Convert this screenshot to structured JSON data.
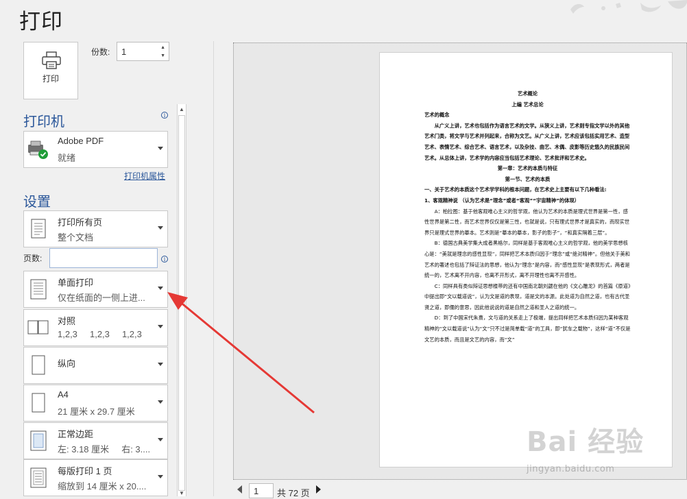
{
  "title": "打印",
  "print_button": {
    "label": "打印",
    "icon": "printer-icon"
  },
  "copies": {
    "label": "份数:",
    "value": "1"
  },
  "printer": {
    "section_title": "打印机",
    "name": "Adobe PDF",
    "status": "就绪",
    "properties_link": "打印机属性"
  },
  "settings": {
    "section_title": "设置",
    "print_range": {
      "line1": "打印所有页",
      "line2": "整个文档"
    },
    "pages_label": "页数:",
    "pages_value": "",
    "sides": {
      "line1": "单面打印",
      "line2": "仅在纸面的一侧上进..."
    },
    "collate": {
      "line1": "对照",
      "line2": "1,2,3     1,2,3     1,2,3"
    },
    "orientation": {
      "line1": "纵向"
    },
    "paper": {
      "line1": "A4",
      "line2": "21 厘米 x 29.7 厘米"
    },
    "margins": {
      "line1": "正常边距",
      "line2": "左: 3.18 厘米     右: 3...."
    },
    "pages_per_sheet": {
      "line1": "每版打印 1 页",
      "line2": "缩放到 14 厘米 x 20...."
    }
  },
  "pager": {
    "current": "1",
    "total": "共 72 页"
  },
  "document": {
    "lines": [
      "艺术概论",
      "上编  艺术总论",
      "艺术的概念",
      "从广义上讲，艺术也包括作为语言艺术的文学。从狭义上讲，艺术则专指文学以外的其他艺术门类，将文学与艺术并列起来，合称为文艺。从广义上讲，艺术应该包括实用艺术、造型艺术、表情艺术、综合艺术、语言艺术，以及杂技、曲艺、木偶、皮影等历史悠久的民族民间艺术。从总体上讲，艺术学的内容应当包括艺术理论、艺术批评和艺术史。",
      "第一章：艺术的本质与特征",
      "第一节、艺术的本质",
      "一、关于艺术的本质这个艺术学学科的根本问题，在艺术史上主要有以下几种看法:",
      "1、客观精神说  （认为艺术是“理念”或者“客观”“宇宙精神”的体现）",
      "A：柏拉图：基于他客观唯心主义的哲学观，他认为艺术的本质是理式世界是第一性，感性世界是第二性，而艺术世界仅仅是第三性，也就是说，只有理式世界才是真实的，而现实世界只是理式世界的摹本。艺术则是“摹本的摹本，影子的影子”，“和真实隔着三层”。",
      "B：德国古典美学集大成者黑格尔，同样是基于客观唯心主义的哲学观，他的美学思想核心是：“美就是理念的感性显现”，同样把艺术本质归因于“理念”或“绝对精神”。但他关于美和艺术的著述也包括了辩证法的思想，他认为“理念”是内容，而“感性显现”是表现形式，两者是统一的，艺术离不开内容，也离不开形式，离不开理性也离不开感性。",
      "C：同样具有类似辩证思想楼带的还有中国南北朝刘勰在他的《文心雕龙》的首篇《原道》中提出即“文以载道说”，认为文是道的表现，道是文的本源。此处道为自然之道，也有古代圣贤之道，即儒的意思，因此他说说的道是自然之道和圣人之道的统一。",
      "D：到了中国宋代朱熹，文与道的关系走上了极端，提出同样把艺术本质归因为某种客观精神的“文以载道说”认为“文”只不过是简单载“道”的工具，即“犹车之载物”，这样“道”不仅是文艺的本质，而且是文艺的内容，而“文”"
    ]
  },
  "watermark": {
    "logo": "Bai 经验",
    "url": "jingyan.baidu.com"
  }
}
